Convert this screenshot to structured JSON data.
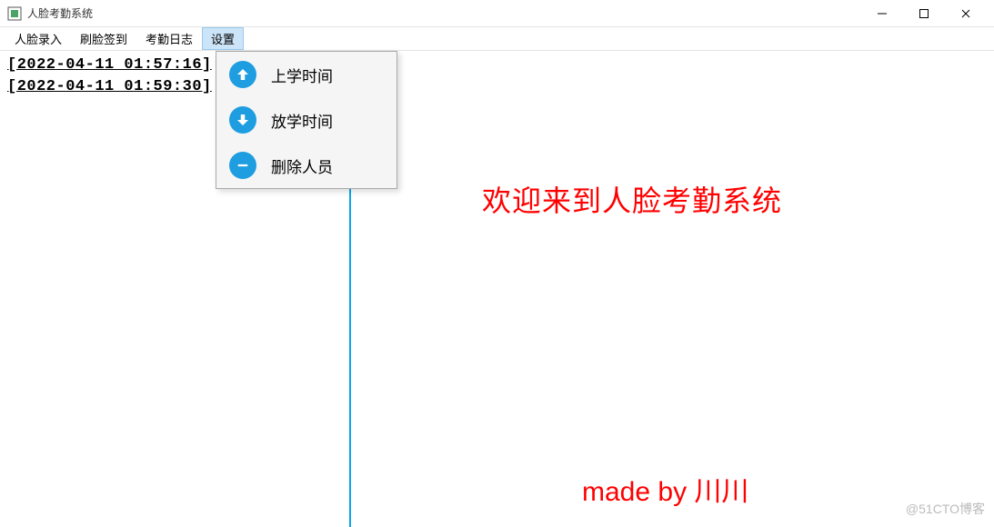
{
  "window": {
    "title": "人脸考勤系统"
  },
  "menubar": {
    "items": [
      {
        "label": "人脸录入",
        "active": false
      },
      {
        "label": "刷脸签到",
        "active": false
      },
      {
        "label": "考勤日志",
        "active": false
      },
      {
        "label": "设置",
        "active": true
      }
    ]
  },
  "dropdown": {
    "items": [
      {
        "icon": "arrow-up",
        "label": "上学时间"
      },
      {
        "icon": "arrow-down",
        "label": "放学时间"
      },
      {
        "icon": "minus",
        "label": "删除人员"
      }
    ]
  },
  "logs": [
    "[2022-04-11 01:57:16]",
    "[2022-04-11 01:59:30]"
  ],
  "main": {
    "welcome": "欢迎来到人脸考勤系统",
    "credit": "made by 川川"
  },
  "watermark": "@51CTO博客",
  "colors": {
    "accent": "#1e9ee0",
    "highlight": "#ff0000"
  }
}
